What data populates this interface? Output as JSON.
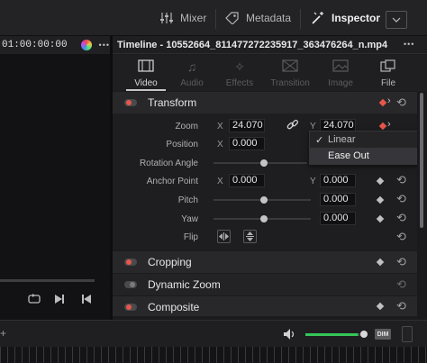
{
  "topbar": {
    "mixer_label": "Mixer",
    "metadata_label": "Metadata",
    "inspector_label": "Inspector",
    "icons": {
      "mixer": "mixer-sliders-icon",
      "metadata": "tag-icon",
      "inspector": "wand-inspector-icon",
      "dropdown": "chevron-down-icon"
    }
  },
  "viewer": {
    "timecode": "01:00:00:00",
    "more": "•••"
  },
  "inspector": {
    "title": "Timeline - 10552664_811477272235917_363476264_n.mp4",
    "more": "•••",
    "tabs": [
      {
        "label": "Video",
        "icon": "film-icon",
        "state": "active"
      },
      {
        "label": "Audio",
        "icon": "music-note-icon",
        "state": "disabled"
      },
      {
        "label": "Effects",
        "icon": "magic-wand-icon",
        "state": "disabled"
      },
      {
        "label": "Transition",
        "icon": "transition-icon",
        "state": "disabled"
      },
      {
        "label": "Image",
        "icon": "image-icon",
        "state": "disabled"
      },
      {
        "label": "File",
        "icon": "file-icon",
        "state": "enabled"
      }
    ],
    "transform": {
      "title": "Transform",
      "zoom": {
        "label": "Zoom",
        "x_axis": "X",
        "x": "24.070",
        "y_axis": "Y",
        "y": "24.070"
      },
      "position": {
        "label": "Position",
        "x_axis": "X",
        "x": "0.000"
      },
      "rotation": {
        "label": "Rotation Angle"
      },
      "anchor": {
        "label": "Anchor Point",
        "x_axis": "X",
        "x": "0.000",
        "y_axis": "Y",
        "y": "0.000"
      },
      "pitch": {
        "label": "Pitch",
        "value": "0.000",
        "level": 0.5
      },
      "yaw": {
        "label": "Yaw",
        "value": "0.000",
        "level": 0.5
      },
      "flip": {
        "label": "Flip"
      }
    },
    "sections": [
      {
        "title": "Cropping",
        "enabled": true
      },
      {
        "title": "Dynamic Zoom",
        "enabled": false
      },
      {
        "title": "Composite",
        "enabled": true
      }
    ],
    "dropdown": {
      "check": "✓",
      "items": [
        {
          "label": "Linear",
          "checked": true
        },
        {
          "label": "Ease Out",
          "checked": false
        }
      ]
    }
  },
  "bottom": {
    "dim_label": "DIM",
    "volume_level": 0.9,
    "colors": {
      "volume": "#34c759",
      "keyframe_active": "#e8564a"
    }
  }
}
